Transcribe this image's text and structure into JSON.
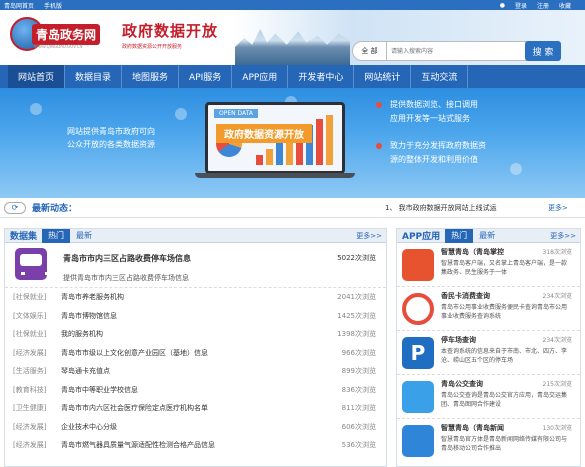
{
  "topbar": {
    "links": [
      "青岛网首页",
      "手机版"
    ],
    "login": "登录",
    "register": "注册",
    "favorite": "收藏"
  },
  "header": {
    "brand": "青岛政务网",
    "brand_sub": "WWW.QINGDAO.GOV.CN",
    "gov_title": "政府数据开放",
    "gov_sub": "政府数据资源公开开放服务",
    "search_scope": "全 部",
    "search_placeholder": "请输入搜索内容",
    "search_button": "搜 索"
  },
  "nav": [
    "网站首页",
    "数据目录",
    "地图服务",
    "API服务",
    "APP应用",
    "开发者中心",
    "网站统计",
    "互动交流"
  ],
  "banner": {
    "left_text": [
      "网站提供青岛市政府可向",
      "公众开放的各类数据资源"
    ],
    "right_text1": [
      "提供数据浏览、接口调用",
      "应用开发等一站式服务"
    ],
    "right_text2": [
      "致力于充分发挥政府数据资",
      "源的整体开发和利用价值"
    ],
    "open_data": "OPEN DATA",
    "title": "政府数据资源开放"
  },
  "news": {
    "label": "最新动态：",
    "item": "1、 我市政府数据开放网站上线试运",
    "more": "更多>"
  },
  "datasets": {
    "tabs": [
      "数据集",
      "热门",
      "最新"
    ],
    "more": "更多>>",
    "featured": {
      "title": "青岛市市内三区占路收费停车场信息",
      "count": "5022次浏览",
      "desc": "提供青岛市市内三区占路收费停车场信息"
    },
    "rows": [
      {
        "cat": "[社保就业]",
        "name": "青岛市养老服务机构",
        "count": "2041次浏览"
      },
      {
        "cat": "[文体娱乐]",
        "name": "青岛市博物馆信息",
        "count": "1425次浏览"
      },
      {
        "cat": "[社保就业]",
        "name": "我的服务机构",
        "count": "1398次浏览"
      },
      {
        "cat": "[经济发展]",
        "name": "青岛市市级以上文化创意产业园区（基地）信息",
        "count": "966次浏览"
      },
      {
        "cat": "[生活服务]",
        "name": "琴岛通卡充值点",
        "count": "899次浏览"
      },
      {
        "cat": "[教育科技]",
        "name": "青岛市中等职业学校信息",
        "count": "836次浏览"
      },
      {
        "cat": "[卫生健康]",
        "name": "青岛市市内六区社会医疗保险定点医疗机构名单",
        "count": "811次浏览"
      },
      {
        "cat": "[经济发展]",
        "name": "企业技术中心分级",
        "count": "606次浏览"
      },
      {
        "cat": "[经济发展]",
        "name": "青岛市燃气器具质量气源适配性检测合格产品信息",
        "count": "536次浏览"
      }
    ]
  },
  "apps": {
    "tabs": [
      "APP应用",
      "热门",
      "最新"
    ],
    "more": "更多>>",
    "items": [
      {
        "name": "智慧青岛（青岛掌控",
        "count": "318次浏览",
        "desc": "智慧青岛客户端，又名掌上青岛客户端，是一款集政务、民生服务于一体",
        "color": "#e8532f"
      },
      {
        "name": "香民卡消费查询",
        "count": "234次浏览",
        "desc": "青岛市公用事业收费服务便民卡查询青岛市公用事业收费服务查询系统",
        "color": "#ffffff"
      },
      {
        "name": "停车场查询",
        "count": "234次浏览",
        "desc": "本查询系统的信息来自于市南、市北、四方、李沧、崂山区五个区的停车场",
        "color": "#1f6ec2"
      },
      {
        "name": "青岛公交查询",
        "count": "215次浏览",
        "desc": "青岛公交查询是青岛公交官方应用，青岛交运集团、青岛图网合作建设",
        "color": "#3aa0e8"
      },
      {
        "name": "智慧青岛（青岛新闻",
        "count": "130次浏览",
        "desc": "智慧青岛官方体是青岛新闻网络传媒有限公司与青岛移动公司合作推出",
        "color": "#2f86d8"
      }
    ]
  }
}
